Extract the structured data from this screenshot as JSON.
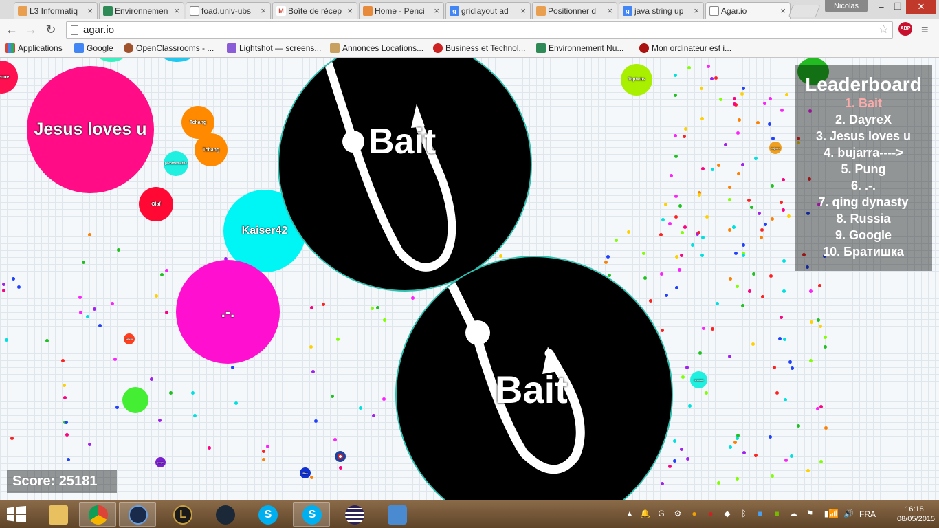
{
  "tabs": [
    {
      "label": "L3 Informatiq",
      "color": "#e8a050"
    },
    {
      "label": "Environnemen",
      "color": "#2e8b57"
    },
    {
      "label": "foad.univ-ubs",
      "color": "#777777"
    },
    {
      "label": "Boîte de récep",
      "color": "#d44638"
    },
    {
      "label": "Home - Penci",
      "color": "#e88a3c"
    },
    {
      "label": "gridlayout ad",
      "color": "#4285f4"
    },
    {
      "label": "Positionner d",
      "color": "#e8a050"
    },
    {
      "label": "java string up",
      "color": "#4285f4"
    },
    {
      "label": "Agar.io",
      "color": "#999999"
    }
  ],
  "window": {
    "profile_name": "Nicolas"
  },
  "toolbar": {
    "url": "agar.io",
    "abp_label": "ABP"
  },
  "bookmarks": [
    {
      "label": "Applications",
      "color": "#d44638"
    },
    {
      "label": "Google",
      "color": "#4285f4"
    },
    {
      "label": "OpenClassrooms - ...",
      "color": "#a0522d"
    },
    {
      "label": "Lightshot — screens...",
      "color": "#8a5cd8"
    },
    {
      "label": "Annonces Locations...",
      "color": "#c8a060"
    },
    {
      "label": "Business et Technol...",
      "color": "#cc2222"
    },
    {
      "label": "Environnement Nu...",
      "color": "#2e8b57"
    },
    {
      "label": "Mon ordinateur est i...",
      "color": "#aa1111"
    }
  ],
  "game": {
    "leaderboard_title": "Leaderboard",
    "leaderboard": [
      "1. Bait",
      "2. DayreX",
      "3. Jesus loves u",
      "4. bujarra---->",
      "5. Pung",
      "6. .-.",
      "7. qing dynasty",
      "8. Russia",
      "9. Google",
      "10. Братишка"
    ],
    "score_label": "Score: 25181",
    "cells": {
      "jesus": "Jesus loves u",
      "kaiser": "Kaiser42",
      "dots": ".-.",
      "tchang1": "Tchang",
      "tchang2": "Tchang",
      "olaf": "Olaf",
      "edge": "bienne",
      "small_cyan": "pwnthemathe",
      "lime": "Thphobs",
      "orange_small": "bujarra",
      "cyan_right": "russian",
      "purple_small": "purple",
      "blue_small": "Bee",
      "red_small": "pellette"
    },
    "bait1": "Bait",
    "bait2": "Bait"
  },
  "taskbar": {
    "apps": [
      "file-explorer",
      "chrome",
      "riot",
      "league-of-legends",
      "steam",
      "skype",
      "skype-alt",
      "eclipse",
      "home-app"
    ],
    "language": "FRA",
    "time": "16:18",
    "date": "08/05/2015"
  }
}
